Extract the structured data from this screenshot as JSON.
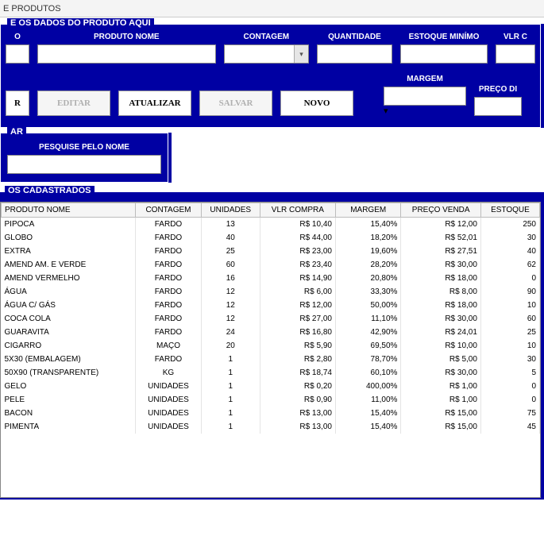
{
  "window": {
    "title": "E PRODUTOS"
  },
  "form": {
    "section_title": "E OS DADOS DO PRODUTO AQUI",
    "fields": {
      "codigo_label": "O",
      "produto_label": "PRODUTO NOME",
      "contagem_label": "CONTAGEM",
      "quantidade_label": "QUANTIDADE",
      "estoque_min_label": "ESTOQUE MINÍMO",
      "vlr_c_label": "VLR C"
    },
    "margem_label": "MARGEM",
    "preco_label": "PREÇO DI"
  },
  "buttons": {
    "cadastrar": "R",
    "editar": "EDITAR",
    "atualizar": "ATUALIZAR",
    "salvar": "SALVAR",
    "novo": "NOVO"
  },
  "search": {
    "section_title": "AR",
    "label": "PESQUISE PELO NOME"
  },
  "grid": {
    "section_title": "OS CADASTRADOS",
    "headers": {
      "produto": "PRODUTO NOME",
      "contagem": "CONTAGEM",
      "unidades": "UNIDADES",
      "vlr_compra": "VLR COMPRA",
      "margem": "MARGEM",
      "preco_venda": "PREÇO VENDA",
      "estoque": "ESTOQUE"
    },
    "rows": [
      {
        "produto": "PIPOCA",
        "contagem": "FARDO",
        "unid": "13",
        "compra": "R$ 10,40",
        "margem": "15,40%",
        "venda": "R$ 12,00",
        "estoque": "250"
      },
      {
        "produto": "GLOBO",
        "contagem": "FARDO",
        "unid": "40",
        "compra": "R$ 44,00",
        "margem": "18,20%",
        "venda": "R$ 52,01",
        "estoque": "30"
      },
      {
        "produto": "EXTRA",
        "contagem": "FARDO",
        "unid": "25",
        "compra": "R$ 23,00",
        "margem": "19,60%",
        "venda": "R$ 27,51",
        "estoque": "40"
      },
      {
        "produto": "AMEND AM. E VERDE",
        "contagem": "FARDO",
        "unid": "60",
        "compra": "R$ 23,40",
        "margem": "28,20%",
        "venda": "R$ 30,00",
        "estoque": "62"
      },
      {
        "produto": "AMEND VERMELHO",
        "contagem": "FARDO",
        "unid": "16",
        "compra": "R$ 14,90",
        "margem": "20,80%",
        "venda": "R$ 18,00",
        "estoque": "0"
      },
      {
        "produto": "ÁGUA",
        "contagem": "FARDO",
        "unid": "12",
        "compra": "R$ 6,00",
        "margem": "33,30%",
        "venda": "R$ 8,00",
        "estoque": "90"
      },
      {
        "produto": "ÁGUA C/ GÁS",
        "contagem": "FARDO",
        "unid": "12",
        "compra": "R$ 12,00",
        "margem": "50,00%",
        "venda": "R$ 18,00",
        "estoque": "10"
      },
      {
        "produto": "COCA COLA",
        "contagem": "FARDO",
        "unid": "12",
        "compra": "R$ 27,00",
        "margem": "11,10%",
        "venda": "R$ 30,00",
        "estoque": "60"
      },
      {
        "produto": "GUARAVITA",
        "contagem": "FARDO",
        "unid": "24",
        "compra": "R$ 16,80",
        "margem": "42,90%",
        "venda": "R$ 24,01",
        "estoque": "25"
      },
      {
        "produto": "CIGARRO",
        "contagem": "MAÇO",
        "unid": "20",
        "compra": "R$ 5,90",
        "margem": "69,50%",
        "venda": "R$ 10,00",
        "estoque": "10"
      },
      {
        "produto": "5X30 (EMBALAGEM)",
        "contagem": "FARDO",
        "unid": "1",
        "compra": "R$ 2,80",
        "margem": "78,70%",
        "venda": "R$ 5,00",
        "estoque": "30"
      },
      {
        "produto": "50X90 (TRANSPARENTE)",
        "contagem": "KG",
        "unid": "1",
        "compra": "R$ 18,74",
        "margem": "60,10%",
        "venda": "R$ 30,00",
        "estoque": "5"
      },
      {
        "produto": "GELO",
        "contagem": "UNIDADES",
        "unid": "1",
        "compra": "R$ 0,20",
        "margem": "400,00%",
        "venda": "R$ 1,00",
        "estoque": "0"
      },
      {
        "produto": "PELE",
        "contagem": "UNIDADES",
        "unid": "1",
        "compra": "R$ 0,90",
        "margem": "11,00%",
        "venda": "R$ 1,00",
        "estoque": "0"
      },
      {
        "produto": "BACON",
        "contagem": "UNIDADES",
        "unid": "1",
        "compra": "R$ 13,00",
        "margem": "15,40%",
        "venda": "R$ 15,00",
        "estoque": "75"
      },
      {
        "produto": "PIMENTA",
        "contagem": "UNIDADES",
        "unid": "1",
        "compra": "R$ 13,00",
        "margem": "15,40%",
        "venda": "R$ 15,00",
        "estoque": "45"
      }
    ]
  }
}
